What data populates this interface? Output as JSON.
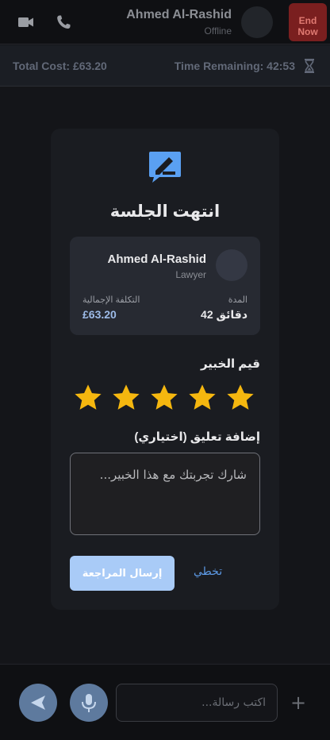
{
  "header": {
    "name": "Ahmed Al-Rashid",
    "status": "Offline",
    "end_line1": "End",
    "end_line2": "Now",
    "icons": [
      "video-camera-icon",
      "phone-icon"
    ]
  },
  "cost_bar": {
    "total_cost": "Total Cost: £63.20",
    "time_remaining": "Time Remaining: 42:53",
    "icon": "hourglass-icon"
  },
  "session_card": {
    "icon": "edit-review-icon",
    "title": "انتهت الجلسة",
    "expert": {
      "name": "Ahmed Al-Rashid",
      "role": "Lawyer",
      "duration_label": "المدة",
      "duration_value": "42 دقائق",
      "cost_label": "التكلفة الإجمالية",
      "cost_value": "£63.20"
    },
    "rating": {
      "label": "قيم الخبير",
      "value": 5,
      "max": 5,
      "star_color": "#f5b70f"
    },
    "comment": {
      "label": "إضافة تعليق (اختياري)",
      "placeholder": "شارك تجربتك مع هذا الخبير...",
      "value": ""
    },
    "submit_label": "إرسال المراجعة",
    "skip_label": "تخطي"
  },
  "composer": {
    "placeholder": "اكتب رسالة...",
    "plus": "+",
    "icons": [
      "send-icon",
      "microphone-icon"
    ]
  },
  "colors": {
    "accent": "#a9cbf7",
    "link": "#5d9ae6",
    "danger": "#7a1f1f",
    "star": "#f5b70f"
  }
}
